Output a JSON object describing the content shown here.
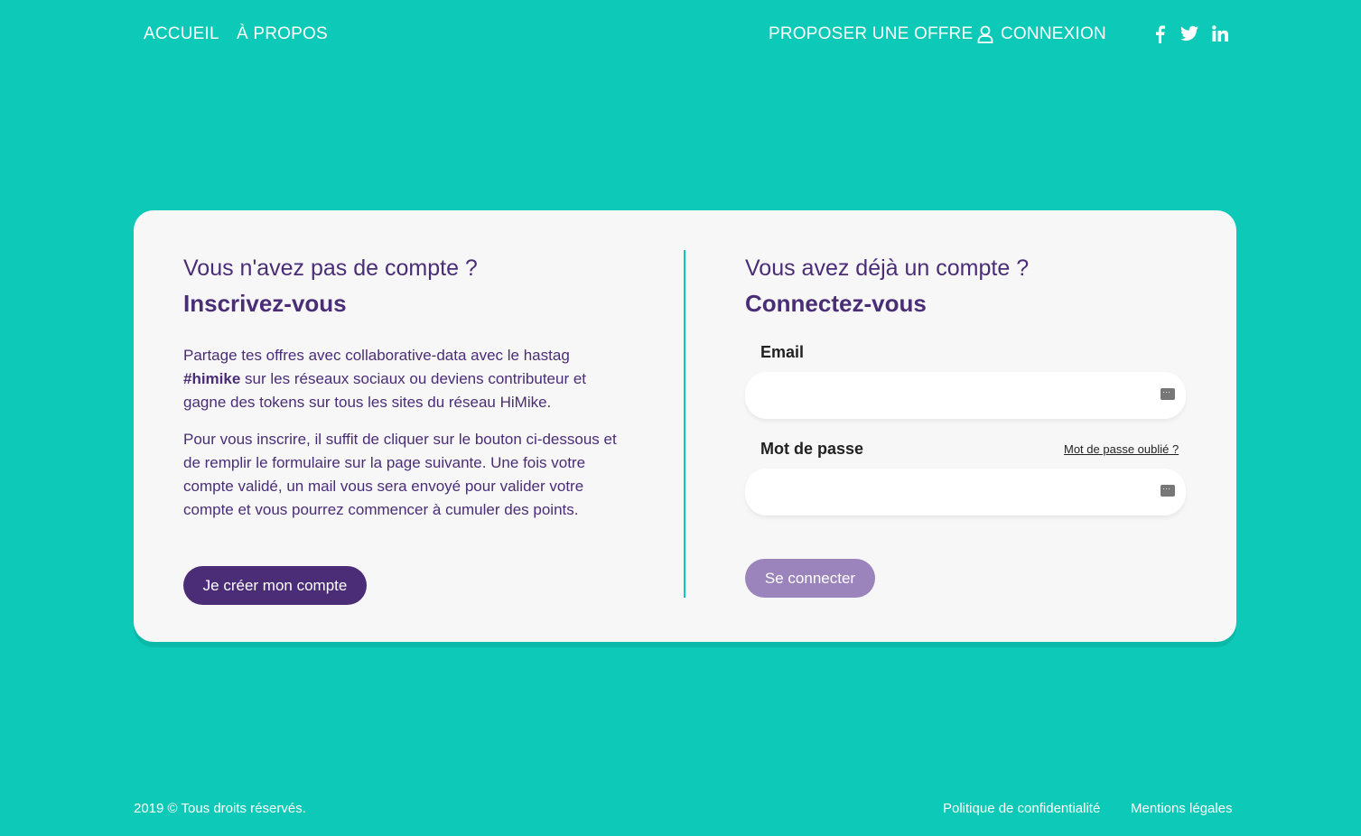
{
  "colors": {
    "background": "#0cc9b8",
    "primary": "#4a2d76",
    "button_disabled": "#9b84bc",
    "card": "#f7f7f7"
  },
  "nav": {
    "home": "ACCUEIL",
    "about": "À PROPOS",
    "propose": "PROPOSER UNE OFFRE",
    "login": "CONNEXION",
    "social": [
      "facebook-icon",
      "twitter-icon",
      "linkedin-icon"
    ]
  },
  "signup": {
    "question": "Vous n'avez pas de compte ?",
    "heading": "Inscrivez-vous",
    "p1_before": "Partage tes offres avec collaborative-data avec le hastag ",
    "p1_bold": "#himike",
    "p1_after": " sur les réseaux sociaux ou deviens contributeur et gagne des tokens sur tous les sites du réseau HiMike.",
    "p2": "Pour vous inscrire, il suffit de cliquer sur le bouton ci-dessous et de remplir le formulaire sur la page suivante. Une fois votre compte validé, un mail vous sera envoyé pour valider votre compte et vous pourrez commencer à cumuler des points.",
    "button": "Je créer mon compte"
  },
  "login": {
    "question": "Vous avez déjà un compte ?",
    "heading": "Connectez-vous",
    "email_label": "Email",
    "email_value": "",
    "password_label": "Mot de passe",
    "password_value": "",
    "forgot": "Mot de passe oublié ?",
    "button": "Se connecter"
  },
  "footer": {
    "copyright": "2019 © Tous droits réservés.",
    "privacy": "Politique de confidentialité",
    "legal": "Mentions légales"
  }
}
